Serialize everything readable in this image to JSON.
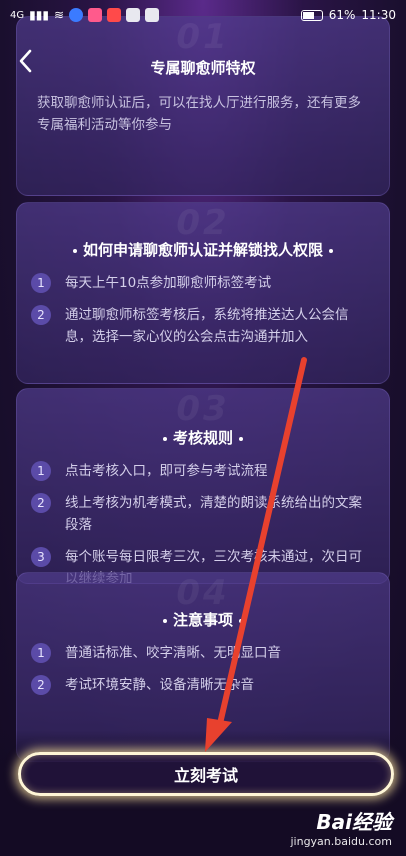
{
  "status_bar": {
    "signal": "4G",
    "battery_percent": "61%",
    "time": "11:30"
  },
  "cards": [
    {
      "number": "01",
      "title": "专属聊愈师特权",
      "description": "获取聊愈师认证后，可以在找人厅进行服务，还有更多专属福利活动等你参与"
    },
    {
      "number": "02",
      "title": "如何申请聊愈师认证并解锁找人权限",
      "items": [
        {
          "num": "1",
          "text": "每天上午10点参加聊愈师标签考试"
        },
        {
          "num": "2",
          "text": "通过聊愈师标签考核后，系统将推送达人公会信息，选择一家心仪的公会点击沟通并加入"
        }
      ]
    },
    {
      "number": "03",
      "title": "考核规则",
      "items": [
        {
          "num": "1",
          "text": "点击考核入口，即可参与考试流程"
        },
        {
          "num": "2",
          "text": "线上考核为机考模式，清楚的朗读系统给出的文案段落"
        },
        {
          "num": "3",
          "text": "每个账号每日限考三次，三次考核未通过，次日可以继续参加"
        }
      ]
    },
    {
      "number": "04",
      "title": "注意事项",
      "items": [
        {
          "num": "1",
          "text": "普通话标准、咬字清晰、无明显口音"
        },
        {
          "num": "2",
          "text": "考试环境安静、设备清晰无杂音"
        }
      ]
    }
  ],
  "exam_button": {
    "label": "立刻考试"
  },
  "watermark": {
    "logo": "Bai经验",
    "url": "jingyan.baidu.com"
  },
  "colors": {
    "background": "#1a0f2e",
    "card": "#3f2f78",
    "badge": "#5b4ba8",
    "button_glow": "#fff6d6",
    "arrow": "#e8412e"
  }
}
